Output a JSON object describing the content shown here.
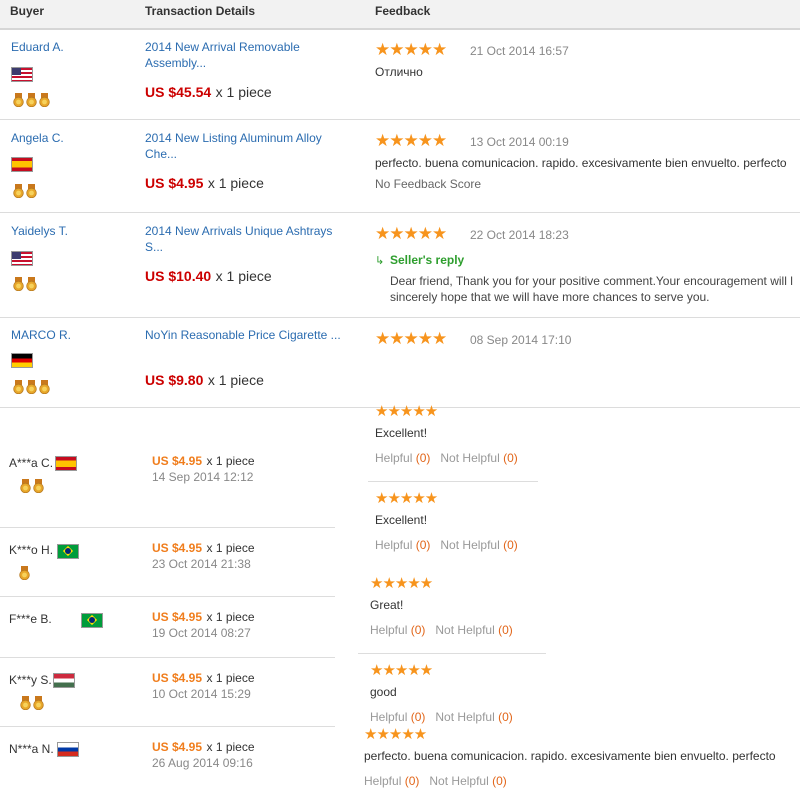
{
  "header": {
    "buyer": "Buyer",
    "details": "Transaction Details",
    "feedback": "Feedback"
  },
  "colors": {
    "link": "#2b6cb0",
    "price": "#cc0000",
    "star": "#f7941d",
    "reply": "#2e9e2e",
    "orange": "#f07d1c"
  },
  "star_glyphs": "★★★★★",
  "unit_label": "x 1 piece",
  "rows": [
    {
      "buyer": "Eduard A.",
      "country": "us",
      "medals": 3,
      "title_line1": "2014 New Arrival Removable",
      "title_line2": "Assembly...",
      "price": "US $45.54",
      "rating": 5,
      "date": "21 Oct 2014 16:57",
      "feedback": "Отлично"
    },
    {
      "buyer": "Angela C.",
      "country": "es",
      "medals": 2,
      "title_line1": "2014 New Listing Aluminum Alloy",
      "title_line2": "Che...",
      "price": "US $4.95",
      "rating": 5,
      "date": "13 Oct 2014 00:19",
      "feedback": "perfecto. buena comunicacion. rapido. excesivamente bien envuelto. perfecto",
      "no_score": "No Feedback Score"
    },
    {
      "buyer": "Yaidelys T.",
      "country": "us",
      "medals": 2,
      "title_line1": "2014 New Arrivals Unique Ashtrays",
      "title_line2": "S...",
      "price": "US $10.40",
      "rating": 5,
      "date": "22 Oct 2014 18:23",
      "reply_label": "Seller's reply",
      "reply_line1": "Dear friend, Thank you for your positive comment.Your encouragement will l",
      "reply_line2": "sincerely hope that we will have more chances to serve you."
    },
    {
      "buyer": "MARCO R.",
      "country": "de",
      "medals": 3,
      "title_line1": "NoYin Reasonable Price Cigarette ...",
      "price": "US $9.80",
      "rating": 5,
      "date": "08 Sep 2014 17:10"
    }
  ],
  "helpful_label": "Helpful",
  "not_helpful_label": "Not Helpful",
  "reviews": [
    {
      "buyer": "A***a C.",
      "country": "es",
      "medals": 2,
      "price": "US $4.95",
      "date": "14 Sep 2014 12:12",
      "text": "Excellent!",
      "helpful": "(0)",
      "not_helpful": "(0)"
    },
    {
      "buyer": "K***o H.",
      "country": "br",
      "medals": 1,
      "price": "US $4.95",
      "date": "23 Oct 2014 21:38",
      "text": "Excellent!",
      "helpful": "(0)",
      "not_helpful": "(0)"
    },
    {
      "buyer": "F***e B.",
      "country": "br",
      "medals": 0,
      "price": "US $4.95",
      "date": "19 Oct 2014 08:27",
      "text": "Great!",
      "helpful": "(0)",
      "not_helpful": "(0)"
    },
    {
      "buyer": "K***y S.",
      "country": "hu",
      "medals": 2,
      "price": "US $4.95",
      "date": "10 Oct 2014 15:29",
      "text": "good",
      "helpful": "(0)",
      "not_helpful": "(0)"
    },
    {
      "buyer": "N***a N.",
      "country": "ru",
      "medals": 0,
      "price": "US $4.95",
      "date": "26 Aug 2014 09:16",
      "text": "perfecto. buena comunicacion. rapido. excesivamente bien envuelto. perfecto",
      "helpful": "(0)",
      "not_helpful": "(0)"
    }
  ]
}
